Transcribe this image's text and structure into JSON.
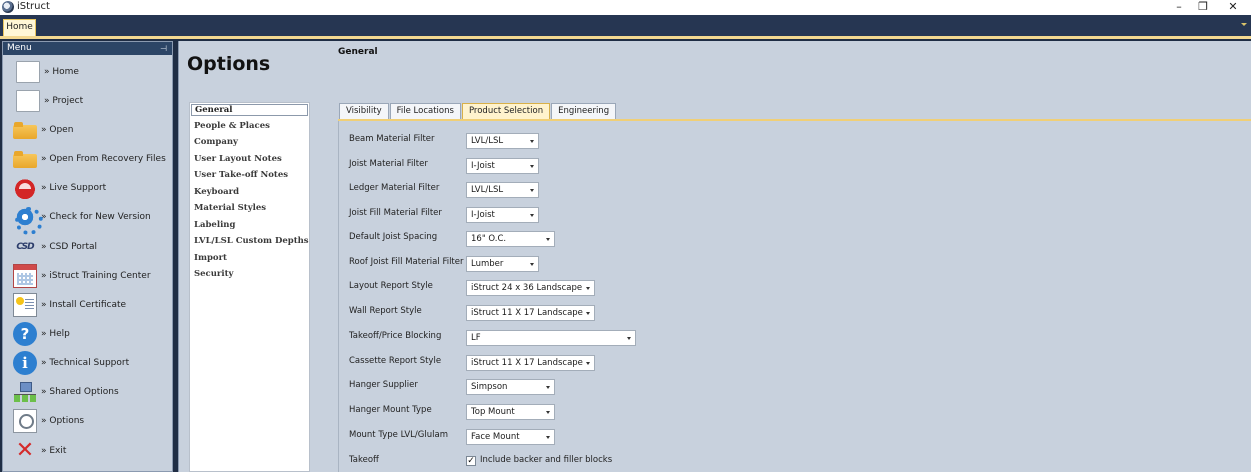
{
  "window": {
    "title": "iStruct",
    "minimize": "–",
    "restore": "❐",
    "close": "✕"
  },
  "ribbon": {
    "tabs": [
      "Home"
    ]
  },
  "menu": {
    "header": "Menu",
    "pin": "⊣",
    "items": [
      {
        "label": "» Home",
        "icon": "page-icon"
      },
      {
        "label": "» Project",
        "icon": "page-icon"
      },
      {
        "label": "» Open",
        "icon": "folder-icon"
      },
      {
        "label": "» Open From Recovery Files",
        "icon": "folder-icon"
      },
      {
        "label": "» Live Support",
        "icon": "phone-icon"
      },
      {
        "label": "» Check for New Version",
        "icon": "gear-icon"
      },
      {
        "label": "» CSD Portal",
        "icon": "csd-logo-icon"
      },
      {
        "label": "» iStruct Training Center",
        "icon": "calendar-icon"
      },
      {
        "label": "» Install Certificate",
        "icon": "certificate-icon"
      },
      {
        "label": "» Help",
        "icon": "help-icon"
      },
      {
        "label": "» Technical Support",
        "icon": "info-icon"
      },
      {
        "label": "» Shared Options",
        "icon": "network-icon"
      },
      {
        "label": "» Options",
        "icon": "options-icon"
      },
      {
        "label": "» Exit",
        "icon": "exit-icon"
      }
    ]
  },
  "options": {
    "title": "Options",
    "section": "General",
    "categories": [
      "General",
      "People & Places",
      "Company",
      "User Layout Notes",
      "User Take-off Notes",
      "Keyboard",
      "Material Styles",
      "Labeling",
      "LVL/LSL Custom Depths",
      "Import",
      "Security"
    ],
    "selected_category": "General",
    "tabs": [
      "Visibility",
      "File Locations",
      "Product Selection",
      "Engineering"
    ],
    "active_tab": "Product Selection",
    "fields": [
      {
        "label": "Beam Material Filter",
        "value": "LVL/LSL"
      },
      {
        "label": "Joist Material Filter",
        "value": "I-Joist"
      },
      {
        "label": "Ledger Material Filter",
        "value": "LVL/LSL"
      },
      {
        "label": "Joist Fill Material Filter",
        "value": "I-Joist"
      },
      {
        "label": "Default Joist Spacing",
        "value": "16\" O.C."
      },
      {
        "label": "Roof Joist Fill Material Filter",
        "value": "Lumber"
      },
      {
        "label": "Layout Report Style",
        "value": "iStruct 24 x 36 Landscape"
      },
      {
        "label": "Wall Report Style",
        "value": "iStruct 11 X 17 Landscape"
      },
      {
        "label": "Takeoff/Price Blocking",
        "value": "LF"
      },
      {
        "label": "Cassette Report Style",
        "value": "iStruct 11 X 17 Landscape"
      },
      {
        "label": "Hanger Supplier",
        "value": "Simpson"
      },
      {
        "label": "Hanger Mount Type",
        "value": "Top Mount"
      },
      {
        "label": "Mount Type LVL/Glulam",
        "value": "Face Mount"
      }
    ],
    "takeoff": {
      "label": "Takeoff",
      "checkbox_label": "Include backer and filler blocks",
      "checked": true,
      "check_glyph": "✓"
    }
  }
}
